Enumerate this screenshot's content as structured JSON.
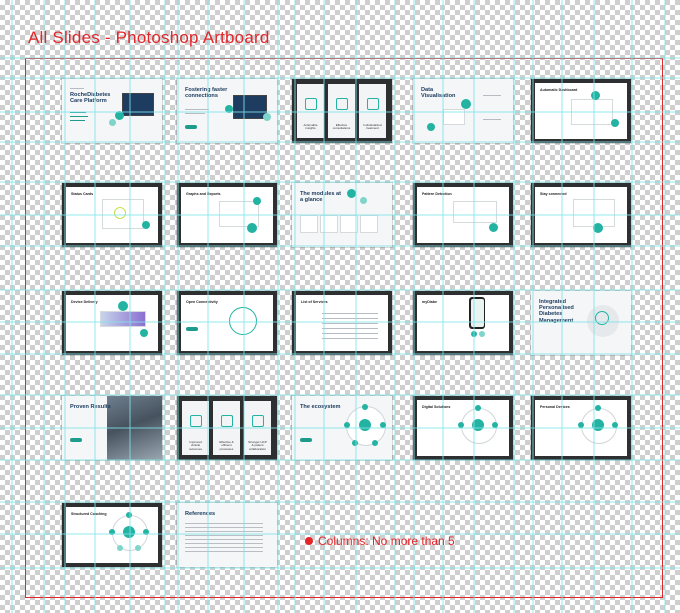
{
  "title": "All Slides - Photoshop Artboard",
  "note": "Columns: No more than 5",
  "colors": {
    "annotation": "#e2262a",
    "guides": "#7fe4ea",
    "brand_teal": "#23b3a2",
    "dark_frame": "#2d2f31"
  },
  "slides": {
    "r1c1": {
      "small": "Introducing",
      "title": "RocheDiabetes Care Platform"
    },
    "r1c2": {
      "title": "Fostering faster connections"
    },
    "r1c3": {
      "panel1": "Actionable insights",
      "panel2": "Effective consultations",
      "panel3": "Individualized treatment"
    },
    "r1c4": {
      "title": "Data Visualisation"
    },
    "r1c5": {
      "title": "Automatic Dashboard"
    },
    "r2c1": {
      "title": "Status Cards"
    },
    "r2c2": {
      "title": "Graphs and Reports"
    },
    "r2c3": {
      "title": "The modules at a glance"
    },
    "r2c4": {
      "title": "Pattern Detection"
    },
    "r2c5": {
      "title": "Stay connected"
    },
    "r3c1": {
      "title": "Device Delivery"
    },
    "r3c2": {
      "title": "Open Connectivity"
    },
    "r3c3": {
      "title": "List of Services"
    },
    "r3c4": {
      "title": "myDiabe"
    },
    "r3c5": {
      "title": "Integrated Personalised Diabetes Management"
    },
    "r4c1": {
      "title": "Proven Results"
    },
    "r4c2": {
      "panel1": "Improved clinical outcomes",
      "panel2": "Effective & efficient processes",
      "panel3": "Stronger HCP & patient collaboration"
    },
    "r4c3": {
      "title": "The ecosystem"
    },
    "r4c4": {
      "title": "Digital Solutions"
    },
    "r4c5": {
      "title": "Personal Devices"
    },
    "r5c1": {
      "title": "Structured Coaching"
    },
    "r5c2": {
      "title": "References"
    }
  }
}
